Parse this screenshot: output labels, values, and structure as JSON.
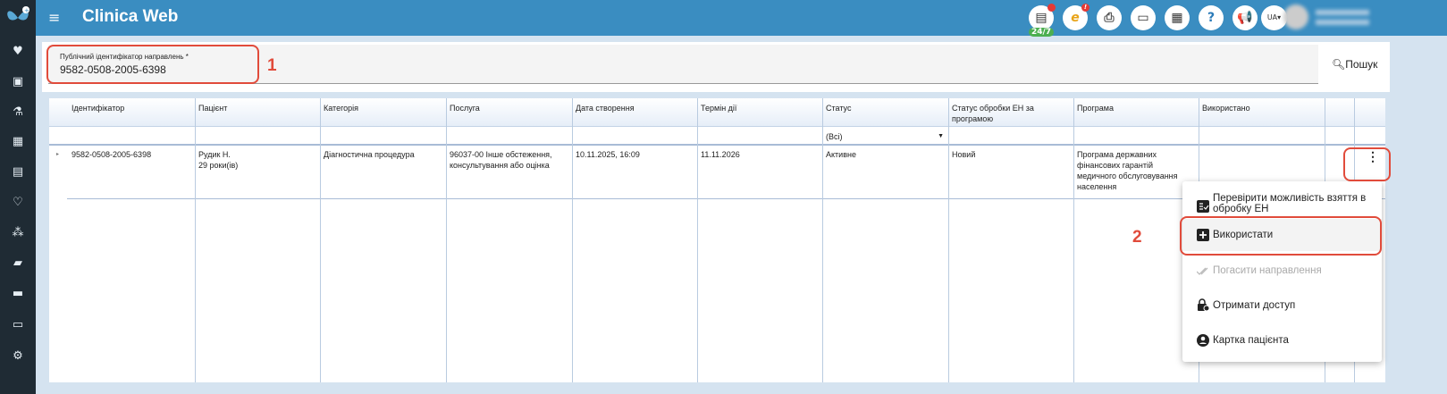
{
  "app": {
    "title": "Clinica Web"
  },
  "topbar": {
    "support_badge": "24/7",
    "lang": "UA",
    "icons": [
      "chat-icon",
      "ehealth-icon",
      "pdf-icon",
      "card-icon",
      "calculator-icon",
      "help-icon",
      "megaphone-icon"
    ]
  },
  "sidebar": {
    "icons": [
      "heart-icon",
      "contact-icon",
      "flask-icon",
      "calendar-icon",
      "document-icon",
      "heartbeat-icon",
      "cubes-icon",
      "book-icon",
      "folder-icon",
      "money-icon",
      "settings-icon"
    ]
  },
  "search": {
    "label": "Публічний ідентифікатор направлень *",
    "value": "9582-0508-2005-6398",
    "button": "Пошук"
  },
  "table": {
    "columns": [
      "Ідентифікатор",
      "Пацієнт",
      "Категорія",
      "Послуга",
      "Дата створення",
      "Термін дії",
      "Статус",
      "Статус обробки ЕН за програмою",
      "Програма",
      "Використано"
    ],
    "status_filter": "(Всі)",
    "rows": [
      {
        "id": "9582-0508-2005-6398",
        "patient": "Рудик Н.",
        "age": "29 роки(ів)",
        "category": "Діагностична процедура",
        "service": "96037-00 Інше обстеження, консультування або оцінка",
        "created": "10.11.2025, 16:09",
        "expires": "11.11.2026",
        "status": "Активне",
        "en_status": "Новий",
        "program": "Програма державних фінансових гарантій медичного обслуговування населення",
        "used": ""
      }
    ]
  },
  "context_menu": {
    "items": [
      {
        "label": "Перевірити можливість взяття в обробку ЕН",
        "icon": "checklist-icon",
        "disabled": false
      },
      {
        "label": "Використати",
        "icon": "plus-box-icon",
        "disabled": false
      },
      {
        "label": "Погасити направлення",
        "icon": "double-check-icon",
        "disabled": true
      },
      {
        "label": "Отримати доступ",
        "icon": "lock-icon",
        "disabled": false
      },
      {
        "label": "Картка пацієнта",
        "icon": "account-circle-icon",
        "disabled": false
      }
    ]
  },
  "annotations": [
    "1",
    "2"
  ],
  "colors": {
    "topbar": "#3a8dc1",
    "sidebar": "#1f2b34",
    "annotation": "#e14b3b"
  }
}
